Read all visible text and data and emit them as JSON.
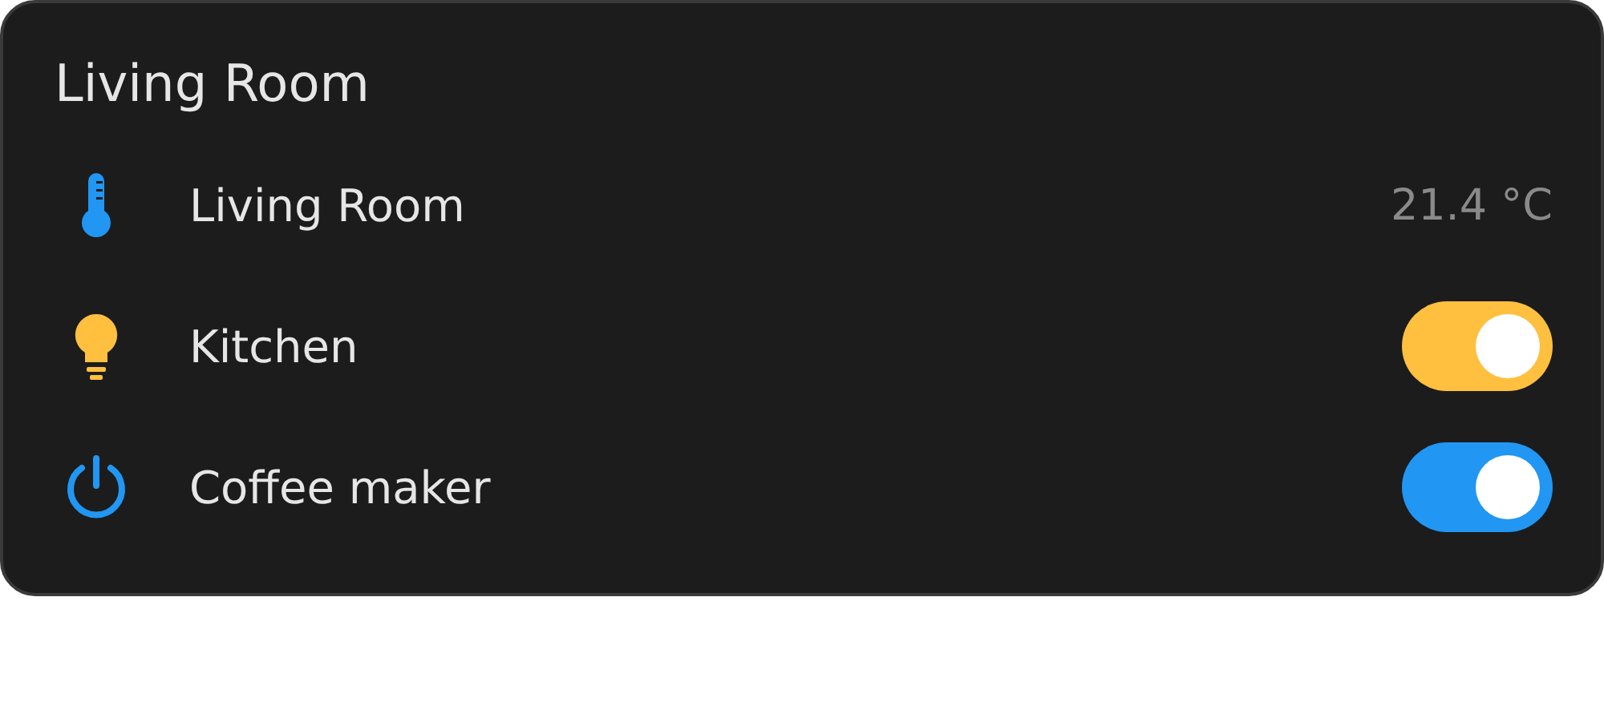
{
  "card": {
    "title": "Living Room",
    "rows": [
      {
        "kind": "sensor",
        "label": "Living Room",
        "value": "21.4 °C",
        "color": "#2196f3"
      },
      {
        "kind": "light",
        "label": "Kitchen",
        "on": true,
        "color": "#ffc03f"
      },
      {
        "kind": "switch",
        "label": "Coffee maker",
        "on": true,
        "color": "#2196f3"
      }
    ]
  }
}
